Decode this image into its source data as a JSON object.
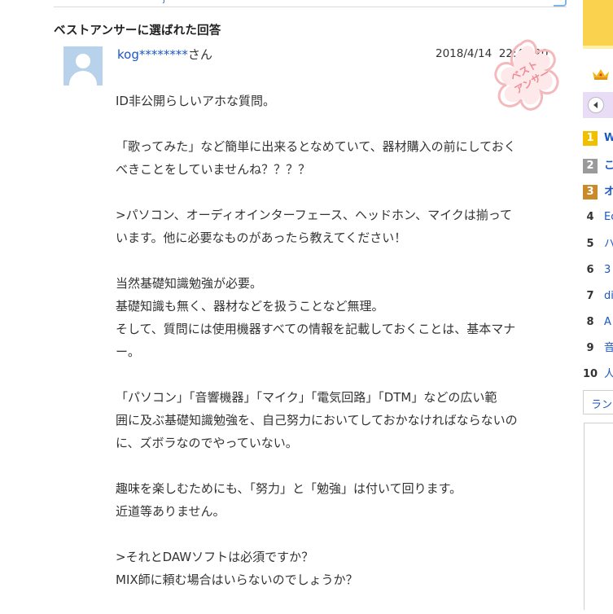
{
  "top": {
    "link_fragment": "j"
  },
  "section_title": "ベストアンサーに選ばれた回答",
  "answer": {
    "username_masked": "kog********",
    "username_suffix": "さん",
    "timestamp": "2018/4/14  22:48:20",
    "stamp_label": "ベストアンサー",
    "paragraphs": [
      [
        "ID非公開らしいアホな質問。"
      ],
      [
        "「歌ってみた」など簡単に出来るとなめていて、器材購入の前にしておく",
        "べきことをしていませんね？？？？"
      ],
      [
        ">パソコン、オーディオインターフェース、ヘッドホン、マイクは揃って",
        "います。他に必要なものがあったら教えてください！"
      ],
      [
        "当然基礎知識勉強が必要。",
        "基礎知識も無く、器材などを扱うことなど無理。",
        "そして、質問には使用機器すべての情報を記載しておくことは、基本マナ",
        "ー。"
      ],
      [
        "「パソコン」「音響機器」「マイク」「電気回路」「DTM」などの広い範",
        "囲に及ぶ基礎知識勉強を、自己努力においてしておかなければならないの",
        "に、ズボラなのでやっていない。"
      ],
      [
        "趣味を楽しむためにも、「努力」と「勉強」は付いて回ります。",
        "近道等ありません。"
      ],
      [
        ">それとDAWソフトは必須ですか？",
        "MIX師に頼む場合はいらないのでしょうか？"
      ]
    ]
  },
  "sidebar": {
    "ranking": [
      {
        "rank": "1",
        "text": "W",
        "bold": true,
        "color": "#f0c000"
      },
      {
        "rank": "2",
        "text": "こ",
        "bold": true,
        "color": "#9a9a9a"
      },
      {
        "rank": "3",
        "text": "オ",
        "bold": true,
        "color": "#c98a2a"
      },
      {
        "rank": "4",
        "text": "Ec",
        "bold": false
      },
      {
        "rank": "5",
        "text": "ハ",
        "bold": false
      },
      {
        "rank": "6",
        "text": "3",
        "bold": false
      },
      {
        "rank": "7",
        "text": "di",
        "bold": false
      },
      {
        "rank": "8",
        "text": "A",
        "bold": false
      },
      {
        "rank": "9",
        "text": "音",
        "bold": false
      },
      {
        "rank": "10",
        "text": "人",
        "bold": false
      }
    ],
    "more_label": "ラン"
  },
  "colors": {
    "link": "#1b57c4",
    "stamp": "#f4b9bd",
    "sidebar_yellow": "#fbd24e",
    "sidebar_purple": "#e8dcf7"
  },
  "icons": {
    "avatar": "default-user-silhouette",
    "crown": "crown-icon",
    "nav": "chevron-left-icon"
  }
}
